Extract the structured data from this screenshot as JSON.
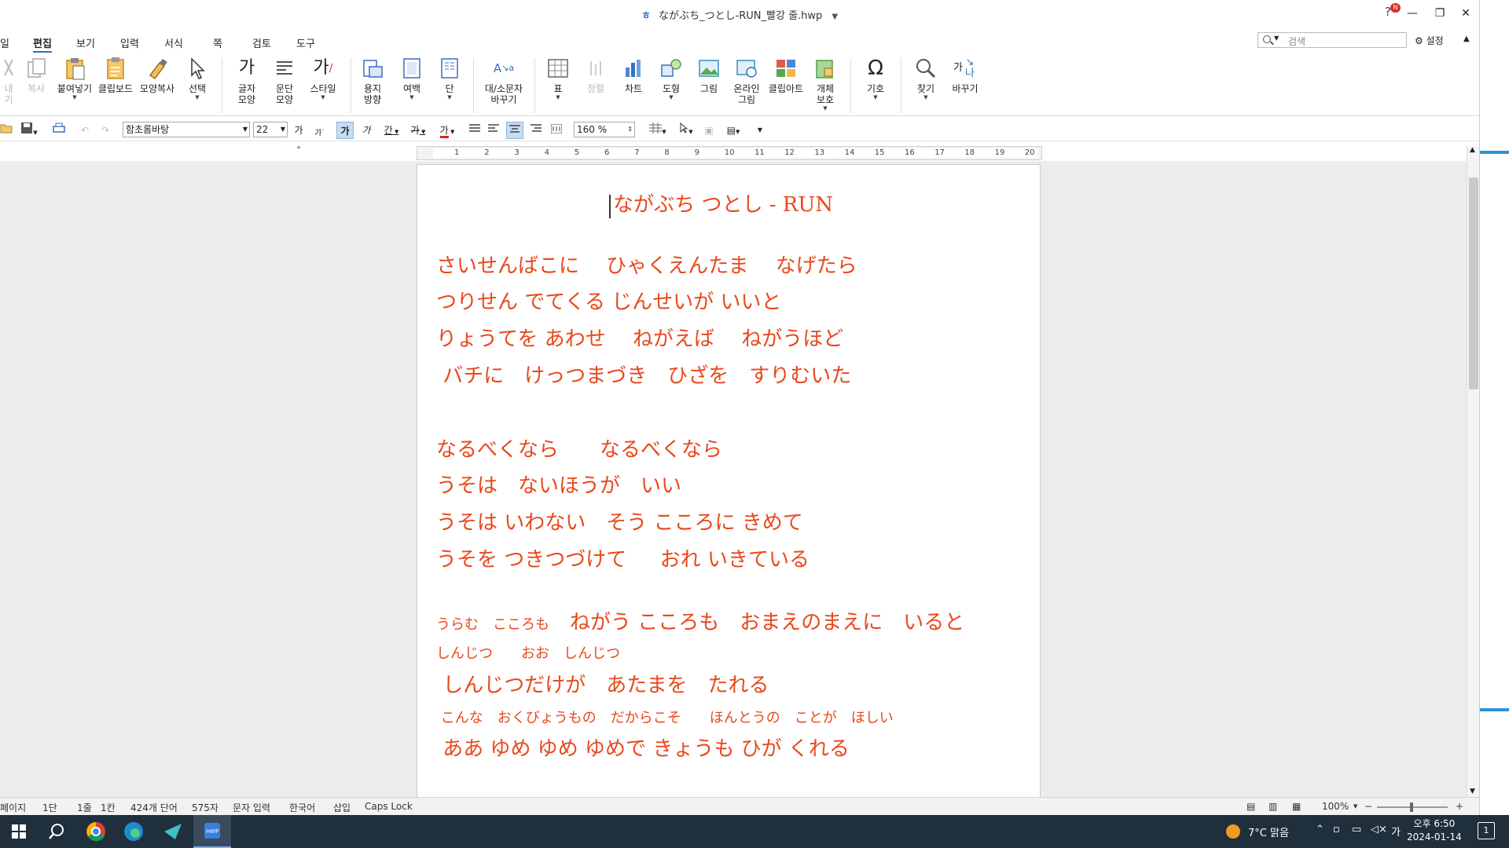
{
  "window": {
    "title": "ながぶち_つとし-RUN_빨강 줄.hwp"
  },
  "menu": [
    "일",
    "편집",
    "보기",
    "입력",
    "서식",
    "쪽",
    "검토",
    "도구"
  ],
  "search": {
    "placeholder": "검색"
  },
  "settings_label": "설정",
  "ribbon": {
    "cut": "내기",
    "copy": "복사",
    "paste": "붙여넣기",
    "clipboard": "클립보드",
    "format_copy": "모양복사",
    "select": "선택",
    "char_shape": [
      "글자",
      "모양"
    ],
    "para_shape": [
      "문단",
      "모양"
    ],
    "style": "스타일",
    "paper_dir": [
      "용지",
      "방향"
    ],
    "margin": "여백",
    "column": "단",
    "case_convert": [
      "대/소문자",
      "바꾸기"
    ],
    "table": "표",
    "align": "정렬",
    "chart": "차트",
    "shape": "도형",
    "picture": "그림",
    "online_picture": [
      "온라인",
      "그림"
    ],
    "clipart": "클립아트",
    "protect": [
      "개체",
      "보호"
    ],
    "symbol": "기호",
    "find": "찾기",
    "replace": "바꾸기"
  },
  "toolbar": {
    "font": "함초롬바탕",
    "size": "22",
    "zoom": "160 %",
    "bold_glyph": "가",
    "italic_glyph": "가",
    "underline_glyph": "간",
    "strike_glyph": "가",
    "color_glyph": "가",
    "inc_glyph": "가",
    "dec_glyph": "가"
  },
  "ruler_ticks": [
    "1",
    "2",
    "3",
    "4",
    "5",
    "6",
    "7",
    "8",
    "9",
    "10",
    "11",
    "12",
    "13",
    "14",
    "15",
    "16",
    "17",
    "18",
    "19",
    "20"
  ],
  "document": {
    "title": "ながぶち つとし - RUN",
    "lines": [
      "さいせんばこに　 ひゃくえんたま 　なげたら",
      "つりせん でてくる じんせいが いいと",
      "りょうてを あわせ 　ねがえば 　ねがうほど",
      " バチに　けっつまづき　ひざを　すりむいた",
      "なるべくなら　　なるべくなら",
      "うそは　ないほうが　いい",
      "うそは いわない　そう こころに きめて",
      "うそを つきつづけて 　 おれ いきている"
    ],
    "line9_ruby": "うらむ　こころも",
    "line9_main": "　ねがう こころも　おまえのまえに　いると",
    "line10_ruby": "しんじつ　　おお　しんじつ",
    "line11": " しんじつだけが　あたまを　たれる",
    "line12_ruby": " こんな　おくびょうもの　だからこそ　　ほんとうの　ことが　ほしい",
    "line13": " ああ ゆめ ゆめ ゆめで きょうも ひが くれる"
  },
  "status": {
    "page": "페이지",
    "col": "1단",
    "line": "1줄",
    "kan": "1칸",
    "words": "424개 단어",
    "chars": "575자",
    "mode": "문자 입력",
    "lang": "한국어",
    "insert": "삽입",
    "caps": "Caps Lock",
    "zoom": "100%"
  },
  "taskbar": {
    "weather": "7°C  맑음",
    "ime": "가",
    "time": "오후 6:50",
    "date": "2024-01-14",
    "notif_count": "1"
  },
  "colors": {
    "lyrics": "#e8481c",
    "accent": "#2a6fd0"
  }
}
